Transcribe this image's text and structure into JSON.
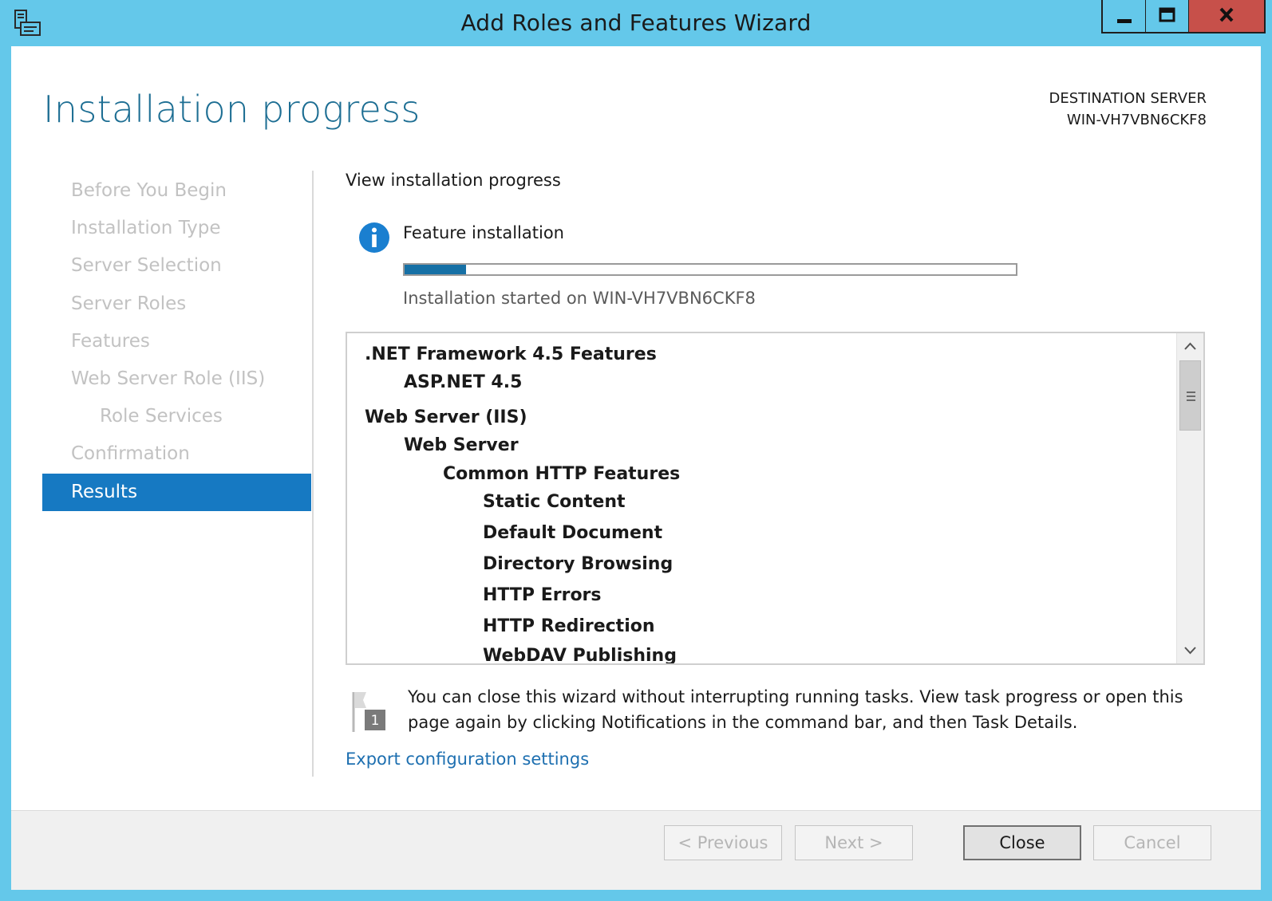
{
  "window": {
    "title": "Add Roles and Features Wizard",
    "minimize_icon": "minimize-icon",
    "maximize_icon": "maximize-icon",
    "close_icon": "close-icon",
    "colors": {
      "frame": "#64c8ea",
      "close": "#c7504a",
      "accent": "#1679c2",
      "title": "#1d6e93"
    }
  },
  "header": {
    "title": "Installation progress",
    "destination_label": "DESTINATION SERVER",
    "destination_server": "WIN-VH7VBN6CKF8"
  },
  "nav": {
    "items": [
      {
        "label": "Before You Begin",
        "active": false,
        "sub": false
      },
      {
        "label": "Installation Type",
        "active": false,
        "sub": false
      },
      {
        "label": "Server Selection",
        "active": false,
        "sub": false
      },
      {
        "label": "Server Roles",
        "active": false,
        "sub": false
      },
      {
        "label": "Features",
        "active": false,
        "sub": false
      },
      {
        "label": "Web Server Role (IIS)",
        "active": false,
        "sub": false
      },
      {
        "label": "Role Services",
        "active": false,
        "sub": true
      },
      {
        "label": "Confirmation",
        "active": false,
        "sub": false
      },
      {
        "label": "Results",
        "active": true,
        "sub": false
      }
    ]
  },
  "content": {
    "section_label": "View installation progress",
    "feature_label": "Feature installation",
    "progress_fraction": 0.1,
    "started_text": "Installation started on WIN-VH7VBN6CKF8",
    "features": [
      {
        "label": ".NET Framework 4.5 Features",
        "level": 0
      },
      {
        "label": "ASP.NET 4.5",
        "level": 1
      },
      {
        "label": "Web Server (IIS)",
        "level": 0
      },
      {
        "label": "Web Server",
        "level": 1
      },
      {
        "label": "Common HTTP Features",
        "level": 2
      },
      {
        "label": "Static Content",
        "level": 3
      },
      {
        "label": "Default Document",
        "level": 3
      },
      {
        "label": "Directory Browsing",
        "level": 3
      },
      {
        "label": "HTTP Errors",
        "level": 3
      },
      {
        "label": "HTTP Redirection",
        "level": 3
      },
      {
        "label": "WebDAV Publishing",
        "level": 3
      }
    ],
    "note_text": "You can close this wizard without interrupting running tasks. View task progress or open this page again by clicking Notifications in the command bar, and then Task Details.",
    "note_badge": "1",
    "export_link": "Export configuration settings"
  },
  "footer": {
    "previous_label": "< Previous",
    "next_label": "Next >",
    "close_label": "Close",
    "cancel_label": "Cancel"
  }
}
